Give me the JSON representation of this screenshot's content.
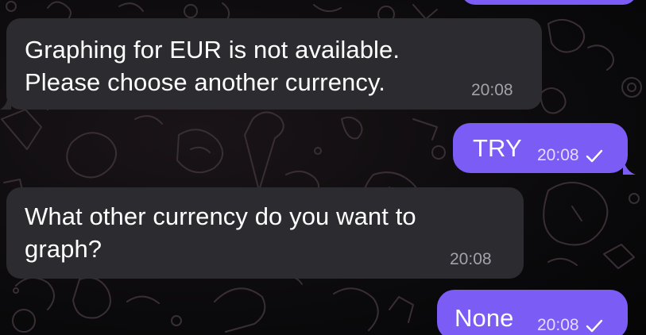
{
  "messages": [
    {
      "id": "m1",
      "direction": "incoming",
      "lines": [
        "Graphing for EUR is not available.",
        "Please choose another currency."
      ],
      "time": "20:08"
    },
    {
      "id": "m2",
      "direction": "outgoing",
      "text": "TRY",
      "time": "20:08",
      "status": "sent-check-icon"
    },
    {
      "id": "m3",
      "direction": "incoming",
      "lines": [
        "What other currency do you want to",
        "graph?"
      ],
      "time": "20:08"
    },
    {
      "id": "m4",
      "direction": "outgoing",
      "text": "None",
      "time": "20:08",
      "status": "sent-check-icon"
    }
  ],
  "colors": {
    "incoming_bubble": "#2c2b30",
    "outgoing_bubble": "#7b5cf5",
    "background": "#0b0a0c",
    "doodle_stroke": "#3a2e35"
  }
}
